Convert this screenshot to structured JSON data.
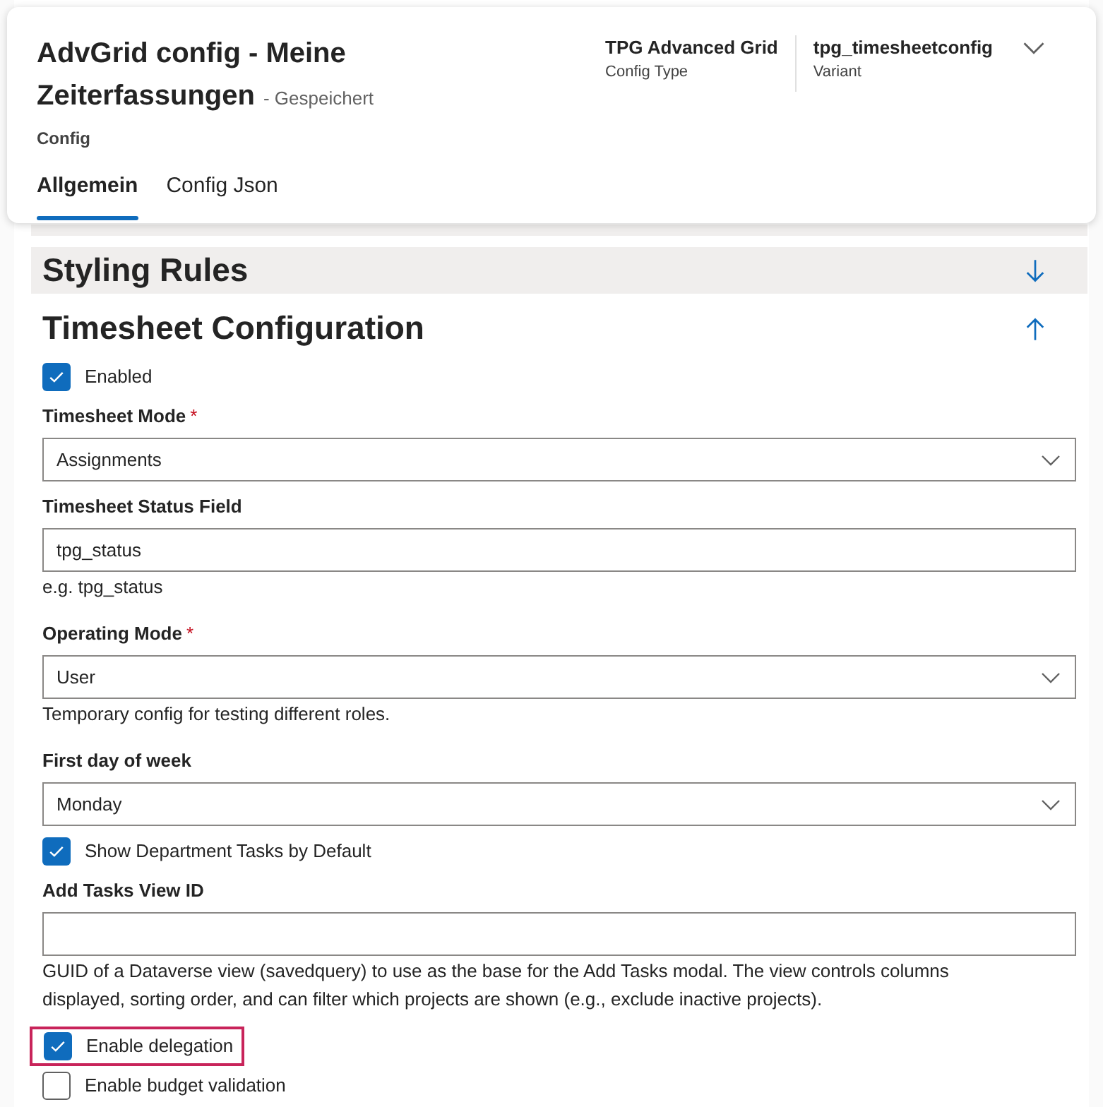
{
  "header": {
    "title": "AdvGrid config - Meine Zeiterfassungen",
    "save_state": "- Gespeichert",
    "entity": "Config",
    "meta": [
      {
        "value": "TPG Advanced Grid",
        "label": "Config Type"
      },
      {
        "value": "tpg_timesheetconfig",
        "label": "Variant"
      }
    ],
    "tabs": [
      {
        "label": "Allgemein",
        "selected": true
      },
      {
        "label": "Config Json",
        "selected": false
      }
    ]
  },
  "sections": [
    {
      "title": "Styling Rules",
      "expanded": false
    },
    {
      "title": "Timesheet Configuration",
      "expanded": true
    }
  ],
  "fields": [
    {
      "kind": "checkbox",
      "label": "Enabled",
      "checked": true,
      "highlighted": false
    },
    {
      "kind": "select",
      "label": "Timesheet Mode",
      "required": true,
      "required_mark": "*",
      "value": "Assignments"
    },
    {
      "kind": "text",
      "label": "Timesheet Status Field",
      "required": false,
      "value": "tpg_status",
      "help": "e.g. tpg_status"
    },
    {
      "kind": "select",
      "label": "Operating Mode",
      "required": true,
      "required_mark": "*",
      "value": "User",
      "help": "Temporary config for testing different roles."
    },
    {
      "kind": "select",
      "label": "First day of week",
      "required": false,
      "value": "Monday"
    },
    {
      "kind": "checkbox",
      "label": "Show Department Tasks by Default",
      "checked": true,
      "highlighted": false
    },
    {
      "kind": "text",
      "label": "Add Tasks View ID",
      "required": false,
      "help": "GUID of a Dataverse view (savedquery) to use as the base for the Add Tasks modal. The view controls columns displayed, sorting order, and can filter which projects are shown (e.g., exclude inactive projects)."
    },
    {
      "kind": "checkbox",
      "label": "Enable delegation",
      "checked": true,
      "highlighted": true
    },
    {
      "kind": "checkbox",
      "label": "Enable budget validation",
      "checked": false,
      "highlighted": false
    }
  ]
}
